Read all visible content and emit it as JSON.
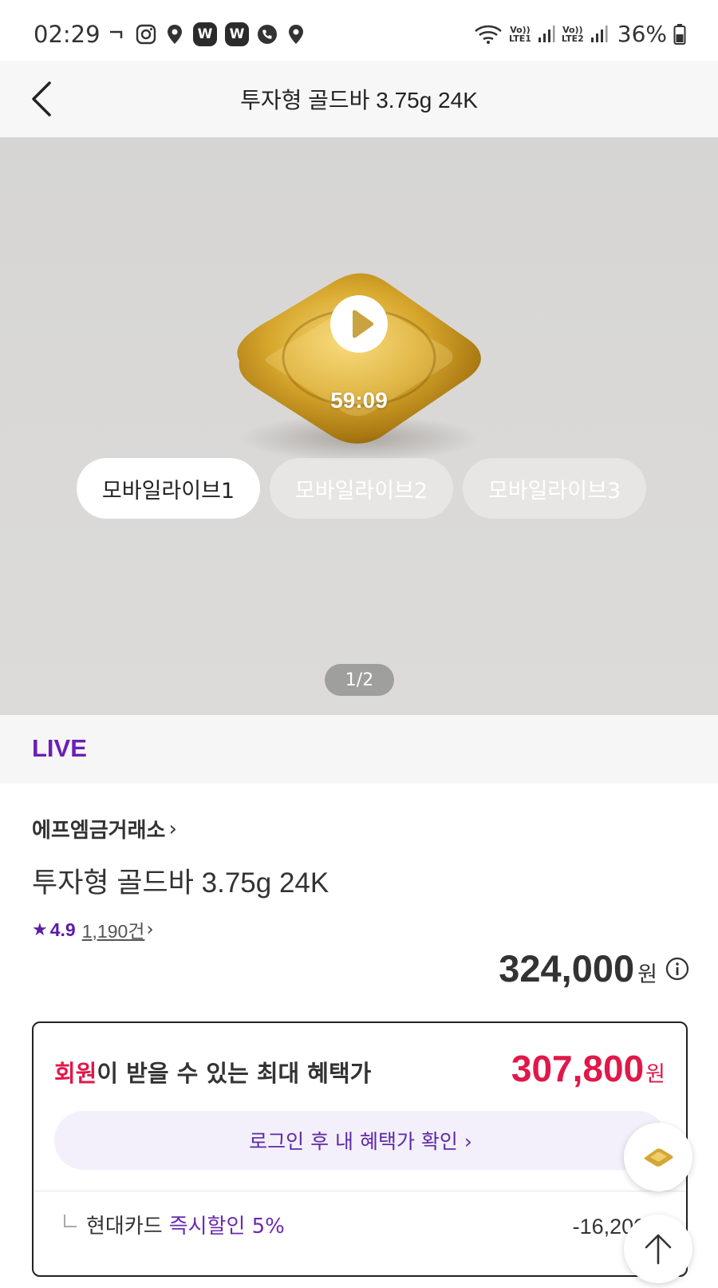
{
  "status_bar": {
    "time": "02:29",
    "battery": "36%",
    "left_icons": [
      "dash-icon",
      "instagram-icon",
      "location-icon",
      "w-app-icon",
      "w-app-icon",
      "phone-icon",
      "location-icon"
    ],
    "w_label": "W",
    "lte1": {
      "top": "Vo))",
      "bottom": "LTE1"
    },
    "lte2": {
      "top": "Vo))",
      "bottom": "LTE2"
    }
  },
  "header": {
    "title": "투자형 골드바 3.75g 24K",
    "back_icon": "chevron-left-icon"
  },
  "media": {
    "duration": "59:09",
    "tabs": [
      {
        "label": "모바일라이브1",
        "active": true
      },
      {
        "label": "모바일라이브2",
        "active": false
      },
      {
        "label": "모바일라이브3",
        "active": false
      }
    ],
    "pager": "1/2"
  },
  "live_label": "LIVE",
  "product": {
    "seller": "에프엠금거래소",
    "seller_arrow": "›",
    "name": "투자형 골드바 3.75g 24K",
    "rating": "4.9",
    "review_count": "1,190건",
    "review_arrow": "›",
    "price": "324,000",
    "price_unit": "원"
  },
  "benefit": {
    "title_accent": "회원",
    "title_rest": "이 받을 수 있는 최대 혜택가",
    "price": "307,800",
    "price_unit": "원",
    "login_label": "로그인 후 내 혜택가 확인 ›",
    "discount": {
      "card": "현대카드",
      "detail": "즉시할인 5%",
      "amount": "-16,200원"
    }
  },
  "colors": {
    "accent_purple": "#6a1fb5",
    "accent_red": "#e0184a",
    "login_bg": "#f3effb"
  }
}
